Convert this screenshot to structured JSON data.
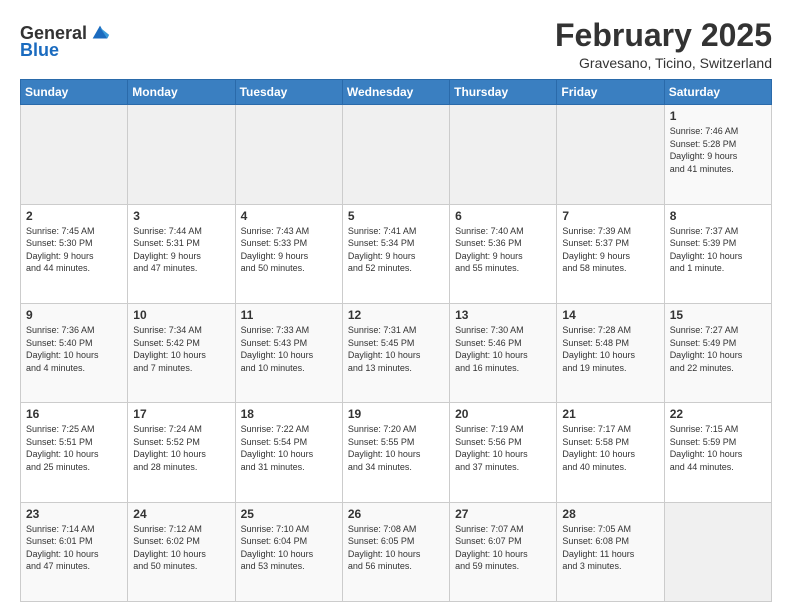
{
  "header": {
    "logo_general": "General",
    "logo_blue": "Blue",
    "month_title": "February 2025",
    "subtitle": "Gravesano, Ticino, Switzerland"
  },
  "days_of_week": [
    "Sunday",
    "Monday",
    "Tuesday",
    "Wednesday",
    "Thursday",
    "Friday",
    "Saturday"
  ],
  "weeks": [
    {
      "days": [
        {
          "num": "",
          "info": "",
          "empty": true
        },
        {
          "num": "",
          "info": "",
          "empty": true
        },
        {
          "num": "",
          "info": "",
          "empty": true
        },
        {
          "num": "",
          "info": "",
          "empty": true
        },
        {
          "num": "",
          "info": "",
          "empty": true
        },
        {
          "num": "",
          "info": "",
          "empty": true
        },
        {
          "num": "1",
          "info": "Sunrise: 7:46 AM\nSunset: 5:28 PM\nDaylight: 9 hours\nand 41 minutes."
        }
      ]
    },
    {
      "days": [
        {
          "num": "2",
          "info": "Sunrise: 7:45 AM\nSunset: 5:30 PM\nDaylight: 9 hours\nand 44 minutes."
        },
        {
          "num": "3",
          "info": "Sunrise: 7:44 AM\nSunset: 5:31 PM\nDaylight: 9 hours\nand 47 minutes."
        },
        {
          "num": "4",
          "info": "Sunrise: 7:43 AM\nSunset: 5:33 PM\nDaylight: 9 hours\nand 50 minutes."
        },
        {
          "num": "5",
          "info": "Sunrise: 7:41 AM\nSunset: 5:34 PM\nDaylight: 9 hours\nand 52 minutes."
        },
        {
          "num": "6",
          "info": "Sunrise: 7:40 AM\nSunset: 5:36 PM\nDaylight: 9 hours\nand 55 minutes."
        },
        {
          "num": "7",
          "info": "Sunrise: 7:39 AM\nSunset: 5:37 PM\nDaylight: 9 hours\nand 58 minutes."
        },
        {
          "num": "8",
          "info": "Sunrise: 7:37 AM\nSunset: 5:39 PM\nDaylight: 10 hours\nand 1 minute."
        }
      ]
    },
    {
      "days": [
        {
          "num": "9",
          "info": "Sunrise: 7:36 AM\nSunset: 5:40 PM\nDaylight: 10 hours\nand 4 minutes."
        },
        {
          "num": "10",
          "info": "Sunrise: 7:34 AM\nSunset: 5:42 PM\nDaylight: 10 hours\nand 7 minutes."
        },
        {
          "num": "11",
          "info": "Sunrise: 7:33 AM\nSunset: 5:43 PM\nDaylight: 10 hours\nand 10 minutes."
        },
        {
          "num": "12",
          "info": "Sunrise: 7:31 AM\nSunset: 5:45 PM\nDaylight: 10 hours\nand 13 minutes."
        },
        {
          "num": "13",
          "info": "Sunrise: 7:30 AM\nSunset: 5:46 PM\nDaylight: 10 hours\nand 16 minutes."
        },
        {
          "num": "14",
          "info": "Sunrise: 7:28 AM\nSunset: 5:48 PM\nDaylight: 10 hours\nand 19 minutes."
        },
        {
          "num": "15",
          "info": "Sunrise: 7:27 AM\nSunset: 5:49 PM\nDaylight: 10 hours\nand 22 minutes."
        }
      ]
    },
    {
      "days": [
        {
          "num": "16",
          "info": "Sunrise: 7:25 AM\nSunset: 5:51 PM\nDaylight: 10 hours\nand 25 minutes."
        },
        {
          "num": "17",
          "info": "Sunrise: 7:24 AM\nSunset: 5:52 PM\nDaylight: 10 hours\nand 28 minutes."
        },
        {
          "num": "18",
          "info": "Sunrise: 7:22 AM\nSunset: 5:54 PM\nDaylight: 10 hours\nand 31 minutes."
        },
        {
          "num": "19",
          "info": "Sunrise: 7:20 AM\nSunset: 5:55 PM\nDaylight: 10 hours\nand 34 minutes."
        },
        {
          "num": "20",
          "info": "Sunrise: 7:19 AM\nSunset: 5:56 PM\nDaylight: 10 hours\nand 37 minutes."
        },
        {
          "num": "21",
          "info": "Sunrise: 7:17 AM\nSunset: 5:58 PM\nDaylight: 10 hours\nand 40 minutes."
        },
        {
          "num": "22",
          "info": "Sunrise: 7:15 AM\nSunset: 5:59 PM\nDaylight: 10 hours\nand 44 minutes."
        }
      ]
    },
    {
      "days": [
        {
          "num": "23",
          "info": "Sunrise: 7:14 AM\nSunset: 6:01 PM\nDaylight: 10 hours\nand 47 minutes."
        },
        {
          "num": "24",
          "info": "Sunrise: 7:12 AM\nSunset: 6:02 PM\nDaylight: 10 hours\nand 50 minutes."
        },
        {
          "num": "25",
          "info": "Sunrise: 7:10 AM\nSunset: 6:04 PM\nDaylight: 10 hours\nand 53 minutes."
        },
        {
          "num": "26",
          "info": "Sunrise: 7:08 AM\nSunset: 6:05 PM\nDaylight: 10 hours\nand 56 minutes."
        },
        {
          "num": "27",
          "info": "Sunrise: 7:07 AM\nSunset: 6:07 PM\nDaylight: 10 hours\nand 59 minutes."
        },
        {
          "num": "28",
          "info": "Sunrise: 7:05 AM\nSunset: 6:08 PM\nDaylight: 11 hours\nand 3 minutes."
        },
        {
          "num": "",
          "info": "",
          "empty": true
        }
      ]
    }
  ]
}
